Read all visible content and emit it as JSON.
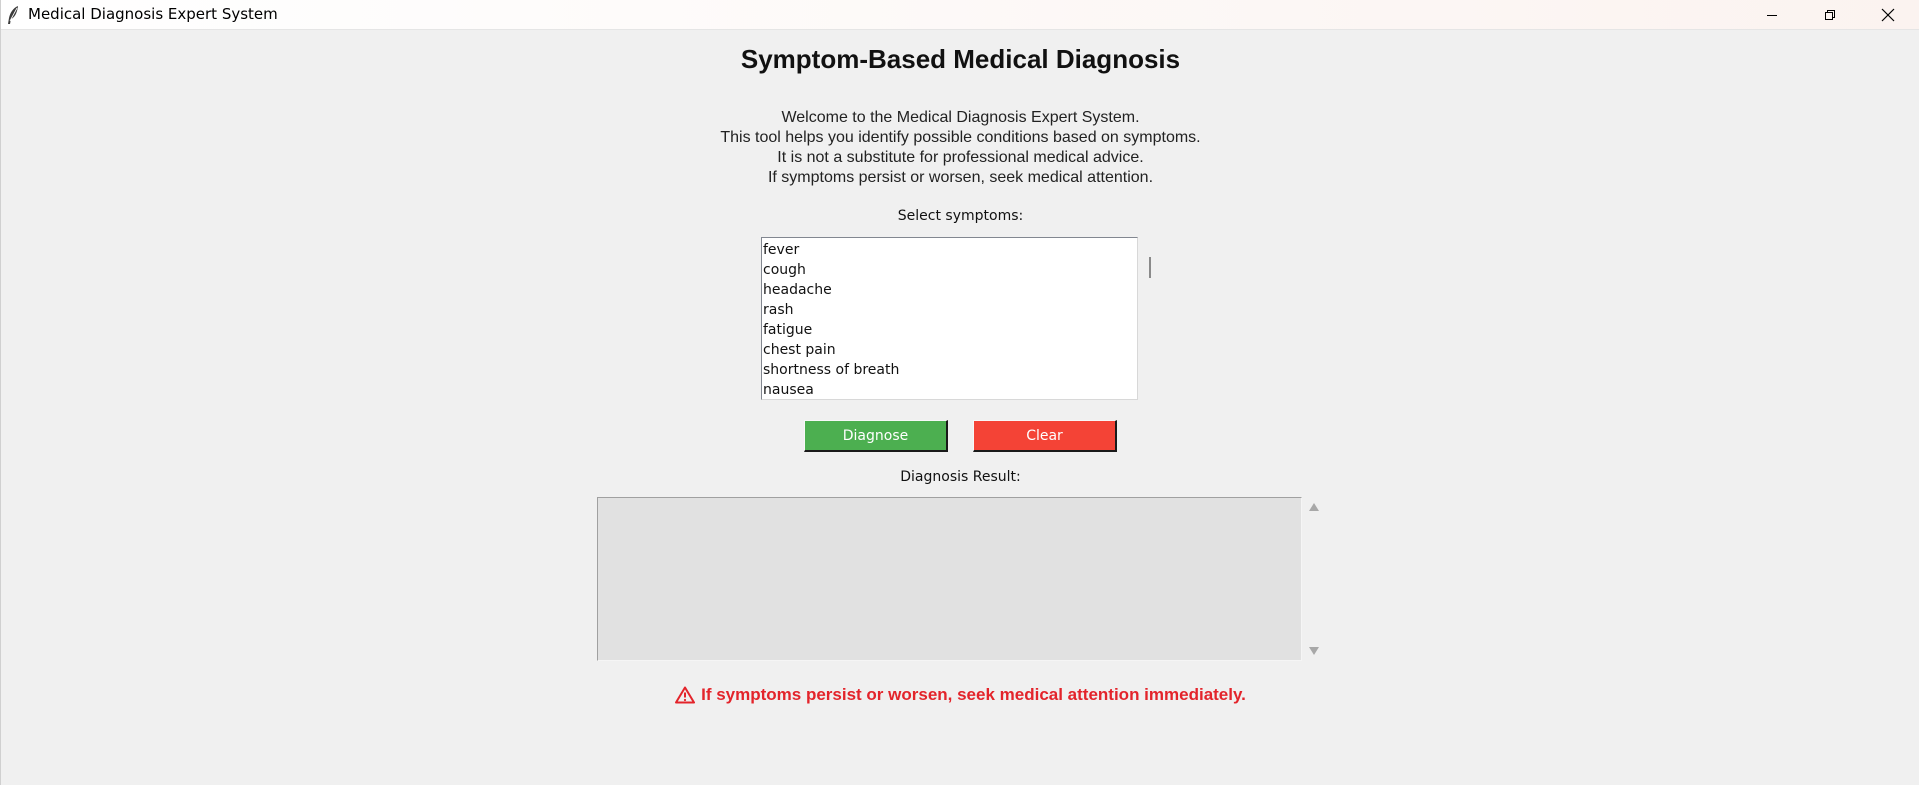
{
  "window": {
    "title": "Medical Diagnosis Expert System"
  },
  "main": {
    "heading": "Symptom-Based Medical Diagnosis",
    "intro_lines": [
      "Welcome to the Medical Diagnosis Expert System.",
      "This tool helps you identify possible conditions based on symptoms.",
      "It is not a substitute for professional medical advice.",
      "If symptoms persist or worsen, seek medical attention."
    ],
    "select_label": "Select symptoms:",
    "symptoms": [
      "fever",
      "cough",
      "headache",
      "rash",
      "fatigue",
      "chest pain",
      "shortness of breath",
      "nausea"
    ],
    "diagnose_label": "Diagnose",
    "clear_label": "Clear",
    "result_label": "Diagnosis Result:",
    "result_text": "",
    "warning_text": "If symptoms persist or worsen, seek medical attention immediately."
  },
  "colors": {
    "diagnose_button": "#4caf50",
    "clear_button": "#f44336",
    "warning": "#e3242b",
    "background": "#f0f0f0"
  },
  "icons": {
    "app": "feather-icon",
    "warning": "warning-triangle-icon"
  }
}
